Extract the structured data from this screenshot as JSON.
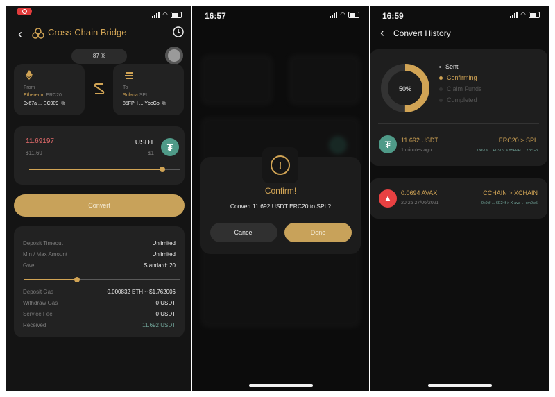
{
  "bridge": {
    "title": "Cross-Chain Bridge",
    "progress_label": "87 %",
    "from": {
      "label": "From",
      "chain": "Ethereum",
      "standard": "ERC20",
      "address": "0x67a ... EC909"
    },
    "to": {
      "label": "To",
      "chain": "Solana",
      "standard": "SPL",
      "address": "85FPH ... YbcGo"
    },
    "amount": {
      "value": "11.69197",
      "usd": "$11.69",
      "token": "USDT",
      "price": "$1",
      "slider_fraction": 0.88
    },
    "convert_label": "Convert",
    "details": [
      {
        "label": "Deposit Timeout",
        "value": "Unlimited"
      },
      {
        "label": "Min / Max Amount",
        "value": "Unlimited"
      },
      {
        "label": "Gwei",
        "value": "Standard: 20"
      }
    ],
    "gas_slider_fraction": 0.34,
    "fees": [
      {
        "label": "Deposit Gas",
        "value": "0.000832 ETH ~ $1.762006"
      },
      {
        "label": "Withdraw Gas",
        "value": "0 USDT"
      },
      {
        "label": "Service Fee",
        "value": "0 USDT"
      },
      {
        "label": "Received",
        "value": "11.692 USDT"
      }
    ]
  },
  "confirm": {
    "time": "16:57",
    "title": "Confirm!",
    "message": "Convert 11.692 USDT ERC20 to SPL?",
    "cancel_label": "Cancel",
    "done_label": "Done"
  },
  "history": {
    "time": "16:59",
    "title": "Convert History",
    "donut_label": "50%",
    "donut_fraction": 0.5,
    "legend": [
      "Sent",
      "Confirming",
      "Claim Funds",
      "Completed"
    ],
    "transactions": [
      {
        "amount": "11.692 USDT",
        "time": "1 minutes ago",
        "route": "ERC20 > SPL",
        "addresses": "0x67a ... EC909 > 85FPH ... YbcGo"
      },
      {
        "amount": "0.0694 AVAX",
        "time": "20:26 27/06/2021",
        "route": "CCHAIN > XCHAIN",
        "addresses": "0x9df ... 6E24f > X-ava ... cm0w5"
      }
    ]
  },
  "colors": {
    "accent_gold": "#d1a455",
    "tether_green": "#4f9a88",
    "avax_red": "#e84142",
    "record_red": "#e23c3c"
  }
}
